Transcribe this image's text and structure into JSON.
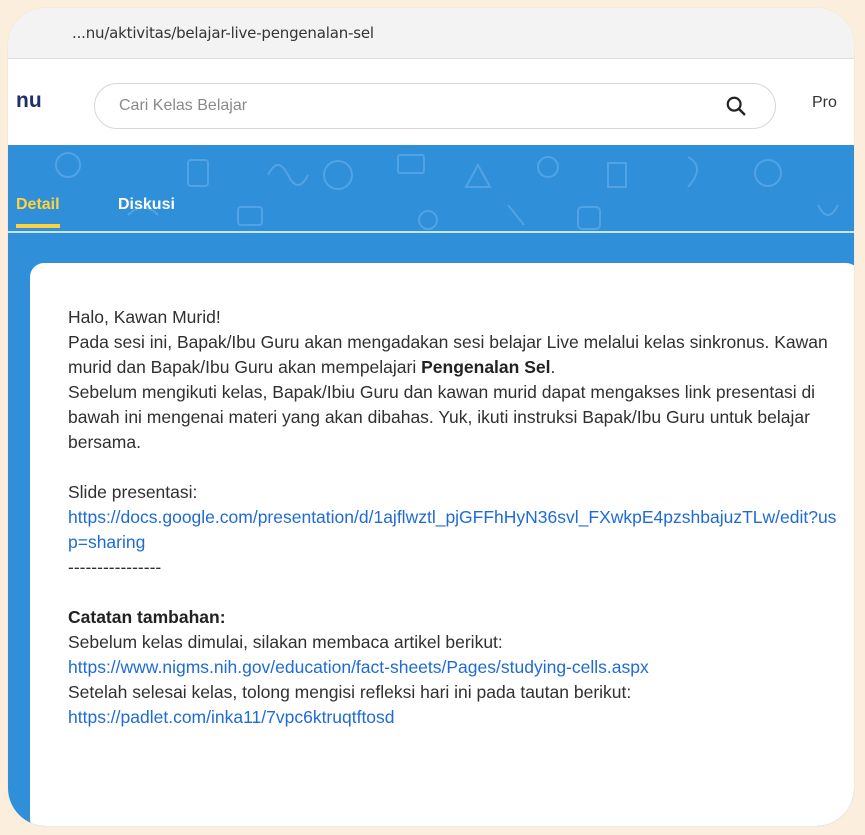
{
  "browser": {
    "url": "...nu/aktivitas/belajar-live-pengenalan-sel"
  },
  "header": {
    "logo_fragment": "nu",
    "search_placeholder": "Cari Kelas Belajar",
    "nav_link": "Pro"
  },
  "tabs": [
    {
      "label": "Detail",
      "active": true
    },
    {
      "label": "Diskusi",
      "active": false
    }
  ],
  "content": {
    "greeting": "Halo, Kawan Murid!",
    "para_before_bold": "Pada sesi ini, Bapak/Ibu Guru akan mengadakan sesi belajar Live melalui kelas sinkronus. Kawan murid dan Bapak/Ibu Guru akan mempelajari ",
    "para_bold": "Pengenalan Sel",
    "para_after_bold": ".",
    "para2": " Sebelum mengikuti kelas, Bapak/Ibiu Guru dan kawan murid dapat mengakses link presentasi di bawah ini mengenai materi yang akan dibahas. Yuk, ikuti instruksi Bapak/Ibu Guru untuk belajar bersama.",
    "slide_label": " Slide presentasi:",
    "slide_link": "https://docs.google.com/presentation/d/1ajflwztl_pjGFFhHyN36svl_FXwkpE4pzshbajuzTLw/edit?usp=sharing",
    "divider": "----------------",
    "notes_heading": "Catatan tambahan:",
    "notes_line1": "Sebelum kelas dimulai, silakan membaca artikel berikut:",
    "article_link": "https://www.nigms.nih.gov/education/fact-sheets/Pages/studying-cells.aspx",
    "notes_line2": "Setelah selesai kelas, tolong mengisi refleksi hari ini pada tautan berikut:",
    "padlet_link": "https://padlet.com/inka11/7vpc6ktruqtftosd"
  },
  "colors": {
    "brand_blue": "#2f8fd8",
    "tab_active": "#ffd23f",
    "link": "#1f6bd6",
    "page_bg": "#fbeedd"
  }
}
